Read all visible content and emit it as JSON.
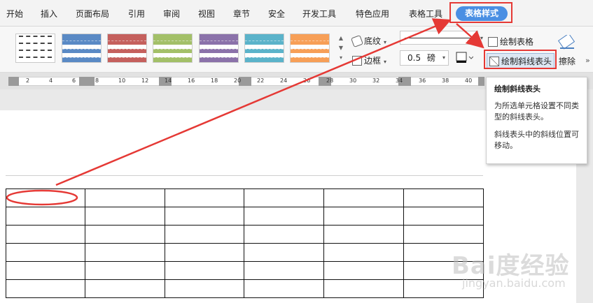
{
  "menu": {
    "items": [
      "开始",
      "插入",
      "页面布局",
      "引用",
      "审阅",
      "视图",
      "章节",
      "安全",
      "开发工具",
      "特色应用",
      "表格工具"
    ],
    "active": "表格样式"
  },
  "ribbon": {
    "style_colors": [
      "#4a7fc0",
      "#c0504d",
      "#9bbb59",
      "#8064a2",
      "#4bacc6",
      "#f79646"
    ],
    "shading_label": "底纹",
    "border_label": "边框",
    "line_width_value": "0.5",
    "line_width_unit": "磅",
    "draw_table_label": "绘制表格",
    "draw_diagonal_label": "绘制斜线表头",
    "erase_label": "擦除"
  },
  "ruler": {
    "labels": [
      "2",
      "4",
      "6",
      "8",
      "10",
      "12",
      "14",
      "16",
      "18",
      "20",
      "22",
      "24",
      "26",
      "28",
      "30",
      "32",
      "34",
      "36",
      "38",
      "40"
    ]
  },
  "tooltip": {
    "title": "绘制斜线表头",
    "desc": "为所选单元格设置不同类型的斜线表头。",
    "note": "斜线表头中的斜线位置可移动。"
  },
  "table": {
    "rows": 6,
    "cols": 6
  },
  "annotation_color": "#e53935",
  "watermark": {
    "main": "Bai度经验",
    "sub": "jingyan.baidu.com"
  }
}
